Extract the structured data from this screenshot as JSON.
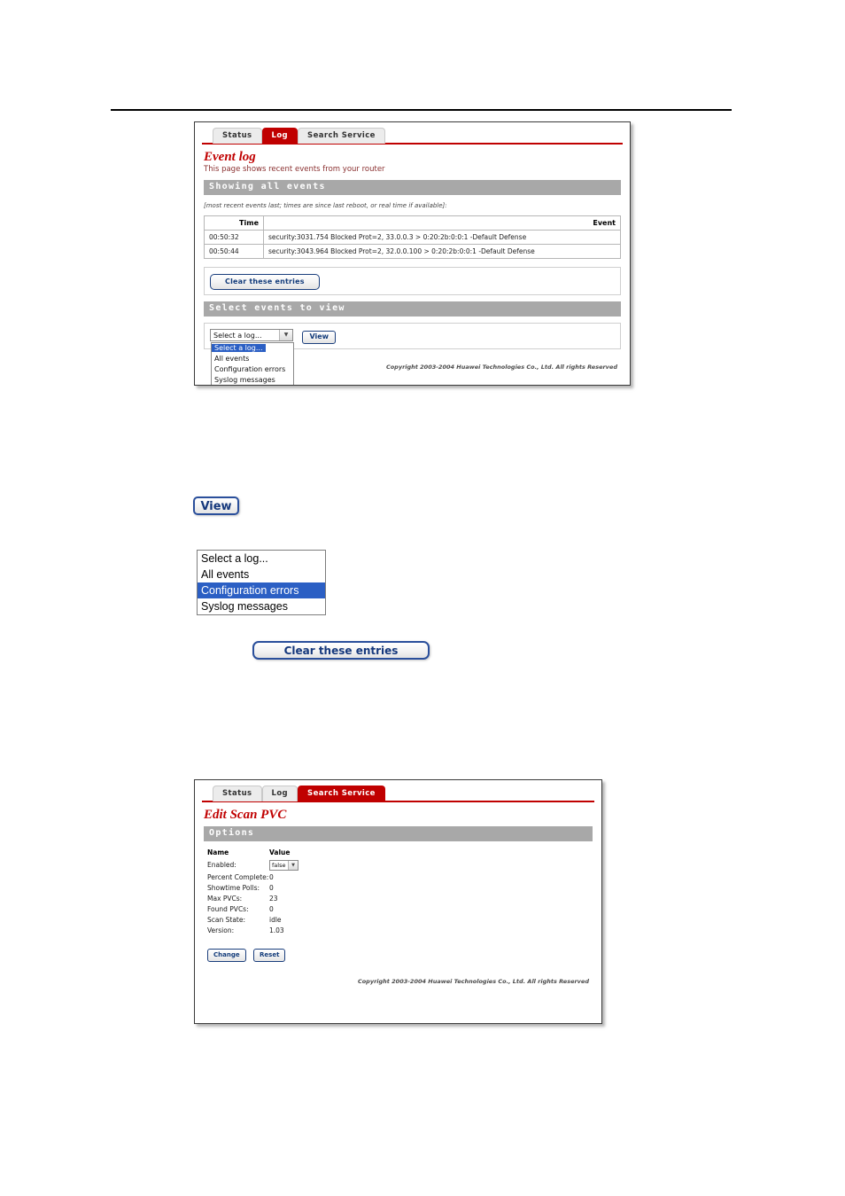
{
  "shot1": {
    "tabs": [
      {
        "label": "Status",
        "active": false
      },
      {
        "label": "Log",
        "active": true
      },
      {
        "label": "Search Service",
        "active": false
      }
    ],
    "title": "Event log",
    "subtitle": "This page shows recent events from your router",
    "section_showing": "Showing all events",
    "note": "[most recent events last; times are since last reboot, or real time if available]:",
    "table": {
      "headers": [
        "Time",
        "Event"
      ],
      "rows": [
        {
          "time": "00:50:32",
          "event": "security:3031.754 Blocked Prot=2, 33.0.0.3 > 0:20:2b:0:0:1 -Default Defense"
        },
        {
          "time": "00:50:44",
          "event": "security:3043.964 Blocked Prot=2, 32.0.0.100 > 0:20:2b:0:0:1 -Default Defense"
        }
      ]
    },
    "clear_button": "Clear these entries",
    "section_select": "Select events to view",
    "select": {
      "value": "Select a log...",
      "options": [
        "Select a log...",
        "All events",
        "Configuration errors",
        "Syslog messages"
      ],
      "highlighted": "Select a log...",
      "arrow_icon": "chevron-down-icon"
    },
    "view_button": "View",
    "copyright": "Copyright 2003-2004 Huawei Technologies Co., Ltd. All rights Reserved"
  },
  "callouts": {
    "view_button": "View",
    "option_list": {
      "options": [
        "Select a log...",
        "All events",
        "Configuration errors",
        "Syslog messages"
      ],
      "highlighted": "Configuration errors"
    },
    "clear_button": "Clear these entries"
  },
  "shot2": {
    "tabs": [
      {
        "label": "Status",
        "active": false
      },
      {
        "label": "Log",
        "active": false
      },
      {
        "label": "Search Service",
        "active": true
      }
    ],
    "title": "Edit Scan PVC",
    "section_options": "Options",
    "grid": {
      "header_name": "Name",
      "header_value": "Value",
      "rows": [
        {
          "name": "Enabled:",
          "value": "false",
          "control": "select"
        },
        {
          "name": "Percent Complete:",
          "value": "0",
          "control": "text"
        },
        {
          "name": "Showtime Polls:",
          "value": "0",
          "control": "text"
        },
        {
          "name": "Max PVCs:",
          "value": "23",
          "control": "text"
        },
        {
          "name": "Found PVCs:",
          "value": "0",
          "control": "text"
        },
        {
          "name": "Scan State:",
          "value": "idle",
          "control": "text"
        },
        {
          "name": "Version:",
          "value": "1.03",
          "control": "text"
        }
      ]
    },
    "change_button": "Change",
    "reset_button": "Reset",
    "copyright": "Copyright 2003-2004 Huawei Technologies Co., Ltd. All rights Reserved",
    "arrow_icon": "chevron-down-icon"
  },
  "colors": {
    "brand_red": "#c00000",
    "section_gray": "#a8a8a8",
    "select_blue": "#2b5fc4",
    "button_blue_text": "#123b7a"
  }
}
